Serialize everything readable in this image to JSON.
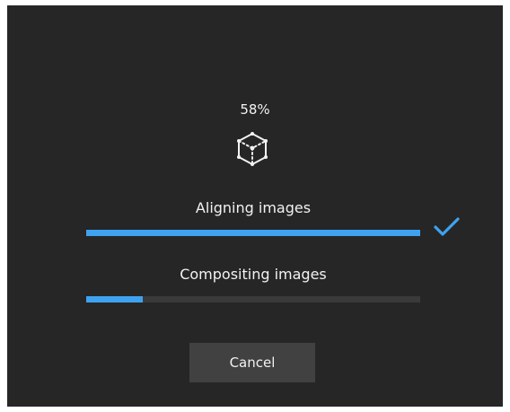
{
  "progress": {
    "percent_label": "58%",
    "icon": "cube-icon"
  },
  "steps": [
    {
      "label": "Aligning images",
      "progress": 1.0,
      "status": "complete",
      "status_icon": "checkmark-icon"
    },
    {
      "label": "Compositing images",
      "progress": 0.17,
      "status": "in-progress"
    }
  ],
  "cancel_label": "Cancel",
  "colors": {
    "dialog_background": "#262626",
    "accent": "#3fa2f0",
    "track": "#3a3a3a",
    "button_background": "#414141",
    "text": "#f2f2f2"
  }
}
